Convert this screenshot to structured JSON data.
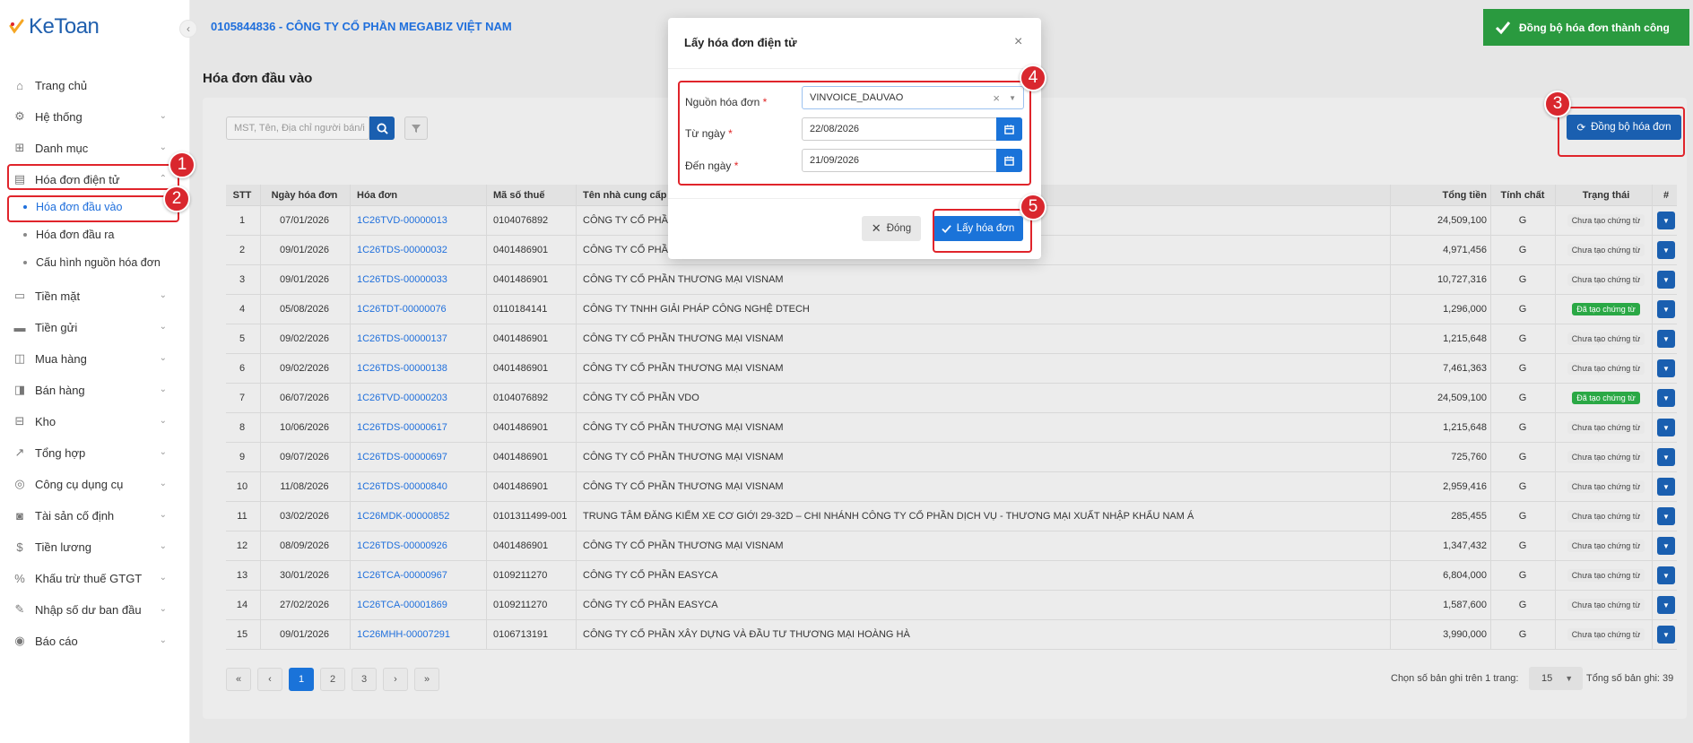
{
  "app": {
    "brand": "KeToan",
    "company": "0105844836 - CÔNG TY CỔ PHẦN MEGABIZ VIỆT NAM"
  },
  "sidebar": {
    "items": [
      {
        "label": "Trang chủ",
        "icon": "home-icon"
      },
      {
        "label": "Hệ thống",
        "icon": "gear-icon"
      },
      {
        "label": "Danh mục",
        "icon": "grid-icon"
      },
      {
        "label": "Hóa đơn điện tử",
        "icon": "invoice-icon"
      },
      {
        "label": "Tiền mặt",
        "icon": "cash-icon"
      },
      {
        "label": "Tiền gửi",
        "icon": "bank-card-icon"
      },
      {
        "label": "Mua hàng",
        "icon": "cart-icon"
      },
      {
        "label": "Bán hàng",
        "icon": "sales-icon"
      },
      {
        "label": "Kho",
        "icon": "warehouse-icon"
      },
      {
        "label": "Tổng hợp",
        "icon": "chart-icon"
      },
      {
        "label": "Công cụ dụng cụ",
        "icon": "tools-icon"
      },
      {
        "label": "Tài sản cố định",
        "icon": "car-icon"
      },
      {
        "label": "Tiền lương",
        "icon": "salary-icon"
      },
      {
        "label": "Khấu trừ thuế GTGT",
        "icon": "tax-icon"
      },
      {
        "label": "Nhập số dư ban đầu",
        "icon": "edit-icon"
      },
      {
        "label": "Báo cáo",
        "icon": "report-icon"
      }
    ],
    "sub_items": [
      "Hóa đơn đầu vào",
      "Hóa đơn đầu ra",
      "Cấu hình nguồn hóa đơn"
    ]
  },
  "page": {
    "title": "Hóa đơn đầu vào",
    "search_placeholder": "MST, Tên, Địa chỉ người bán/i",
    "sync_button": "Đồng bộ hóa đơn"
  },
  "table": {
    "headers": [
      "STT",
      "Ngày hóa đơn",
      "Hóa đơn",
      "Mã số thuế",
      "Tên nhà cung cấp",
      "Tổng tiền",
      "Tính chất",
      "Trạng thái",
      "#"
    ],
    "rows": [
      [
        "1",
        "07/01/2026",
        "1C26TVD-00000013",
        "0104076892",
        "CÔNG TY CỔ PHẦ",
        "24,509,100",
        "G",
        "Chưa tạo chứng từ"
      ],
      [
        "2",
        "09/01/2026",
        "1C26TDS-00000032",
        "0401486901",
        "CÔNG TY CỔ PHẦ",
        "4,971,456",
        "G",
        "Chưa tạo chứng từ"
      ],
      [
        "3",
        "09/01/2026",
        "1C26TDS-00000033",
        "0401486901",
        "CÔNG TY CỔ PHẦN THƯƠNG MẠI VISNAM",
        "10,727,316",
        "G",
        "Chưa tạo chứng từ"
      ],
      [
        "4",
        "05/08/2026",
        "1C26TDT-00000076",
        "0110184141",
        "CÔNG TY TNHH GIẢI PHÁP CÔNG NGHỆ DTECH",
        "1,296,000",
        "G",
        "Đã tạo chứng từ"
      ],
      [
        "5",
        "09/02/2026",
        "1C26TDS-00000137",
        "0401486901",
        "CÔNG TY CỔ PHẦN THƯƠNG MẠI VISNAM",
        "1,215,648",
        "G",
        "Chưa tạo chứng từ"
      ],
      [
        "6",
        "09/02/2026",
        "1C26TDS-00000138",
        "0401486901",
        "CÔNG TY CỔ PHẦN THƯƠNG MẠI VISNAM",
        "7,461,363",
        "G",
        "Chưa tạo chứng từ"
      ],
      [
        "7",
        "06/07/2026",
        "1C26TVD-00000203",
        "0104076892",
        "CÔNG TY CỔ PHẦN VDO",
        "24,509,100",
        "G",
        "Đã tạo chứng từ"
      ],
      [
        "8",
        "10/06/2026",
        "1C26TDS-00000617",
        "0401486901",
        "CÔNG TY CỔ PHẦN THƯƠNG MẠI VISNAM",
        "1,215,648",
        "G",
        "Chưa tạo chứng từ"
      ],
      [
        "9",
        "09/07/2026",
        "1C26TDS-00000697",
        "0401486901",
        "CÔNG TY CỔ PHẦN THƯƠNG MẠI VISNAM",
        "725,760",
        "G",
        "Chưa tạo chứng từ"
      ],
      [
        "10",
        "11/08/2026",
        "1C26TDS-00000840",
        "0401486901",
        "CÔNG TY CỔ PHẦN THƯƠNG MẠI VISNAM",
        "2,959,416",
        "G",
        "Chưa tạo chứng từ"
      ],
      [
        "11",
        "03/02/2026",
        "1C26MDK-00000852",
        "0101311499-001",
        "TRUNG TÂM ĐĂNG KIỂM XE CƠ GIỚI 29-32D – CHI NHÁNH CÔNG TY CỔ PHẦN DỊCH VỤ - THƯƠNG MẠI XUẤT NHẬP KHẨU NAM Á",
        "285,455",
        "G",
        "Chưa tạo chứng từ"
      ],
      [
        "12",
        "08/09/2026",
        "1C26TDS-00000926",
        "0401486901",
        "CÔNG TY CỔ PHẦN THƯƠNG MẠI VISNAM",
        "1,347,432",
        "G",
        "Chưa tạo chứng từ"
      ],
      [
        "13",
        "30/01/2026",
        "1C26TCA-00000967",
        "0109211270",
        "CÔNG TY CỔ PHẦN EASYCA",
        "6,804,000",
        "G",
        "Chưa tạo chứng từ"
      ],
      [
        "14",
        "27/02/2026",
        "1C26TCA-00001869",
        "0109211270",
        "CÔNG TY CỔ PHẦN EASYCA",
        "1,587,600",
        "G",
        "Chưa tạo chứng từ"
      ],
      [
        "15",
        "09/01/2026",
        "1C26MHH-00007291",
        "0106713191",
        "CÔNG TY CỔ PHẦN XÂY DỰNG VÀ ĐẦU TƯ THƯƠNG MẠI HOÀNG HÀ",
        "3,990,000",
        "G",
        "Chưa tạo chứng từ"
      ]
    ]
  },
  "pagination": {
    "first": "«",
    "prev": "‹",
    "pages": [
      "1",
      "2",
      "3"
    ],
    "active_page": "1",
    "next": "›",
    "last": "»",
    "per_page_label": "Chọn số bản ghi trên 1 trang:",
    "per_page": "15",
    "total_label": "Tổng số bản ghi:",
    "total": "39"
  },
  "toast": {
    "message": "Đồng bộ hóa đơn thành công"
  },
  "modal": {
    "title": "Lấy hóa đơn điện tử",
    "source_label": "Nguồn hóa đơn",
    "source_value": "VINVOICE_DAUVAO",
    "from_label": "Từ ngày",
    "from_value": "22/08/2026",
    "to_label": "Đến ngày",
    "to_value": "21/09/2026",
    "required_mark": "*",
    "close_button": "Đóng",
    "submit_button": "Lấy hóa đơn"
  },
  "annotations": [
    "1",
    "2",
    "3",
    "4",
    "5"
  ],
  "colors": {
    "primary": "#1a73d9",
    "annotation": "#e0242b",
    "success": "#2a9a3f"
  }
}
